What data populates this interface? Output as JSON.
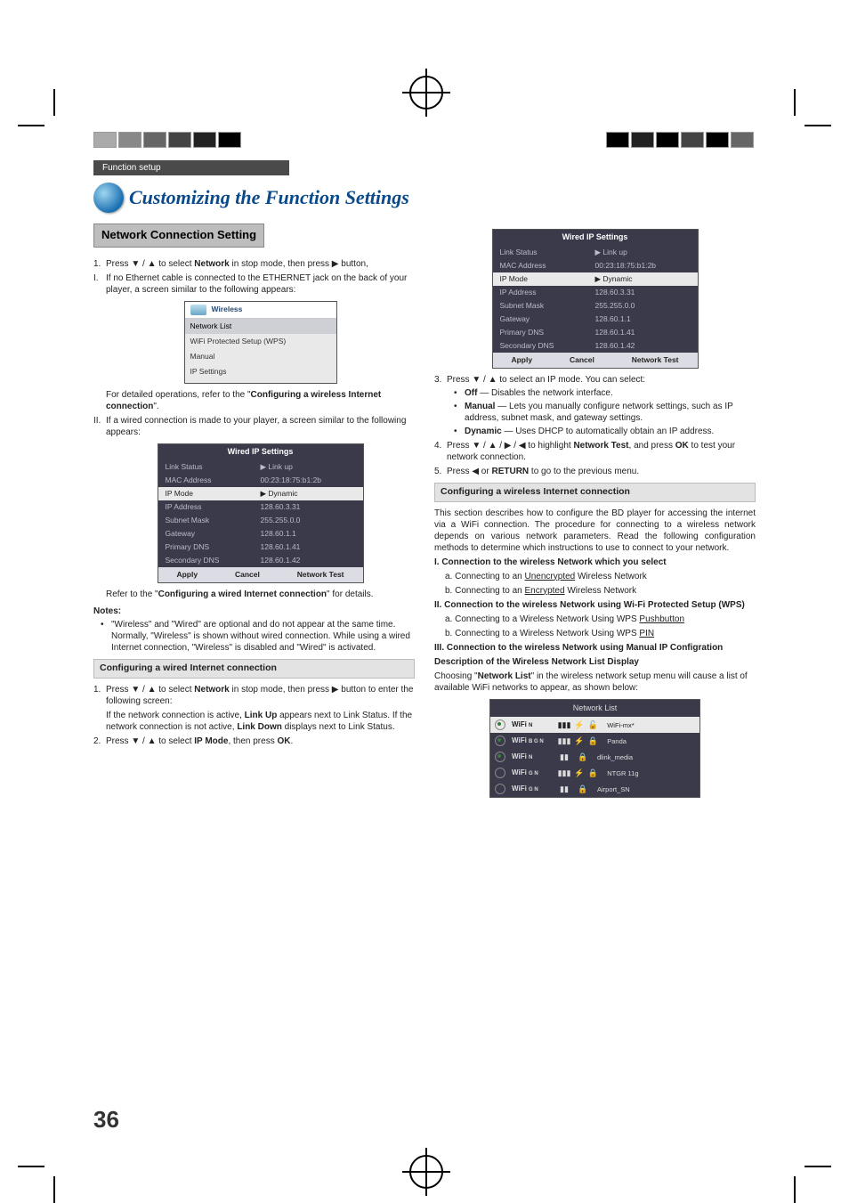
{
  "header": {
    "breadcrumb": "Function setup"
  },
  "title": "Customizing the Function Settings",
  "left": {
    "section_title": "Network Connection Setting",
    "step1_pre": "Press ▼ / ▲ to select ",
    "step1_bold": "Network",
    "step1_post": " in stop mode, then press ▶ button,",
    "sI_label": "I.",
    "sI_text": "If no Ethernet cable is connected to the ETHERNET jack on the back of your player, a screen similar to the following appears:",
    "wireless_box": {
      "title": "Wireless",
      "items": [
        "Network List",
        "WiFi Protected Setup (WPS)",
        "Manual",
        "IP Settings"
      ]
    },
    "sI_ref_pre": "For detailed operations, refer to the \"",
    "sI_ref_bold": "Configuring a wireless Internet connection",
    "sI_ref_post": "\".",
    "sII_label": "II.",
    "sII_text": "If a wired connection is made to your player, a screen similar to the following appears:",
    "wired_table": {
      "title": "Wired IP Settings",
      "rows": [
        {
          "k": "Link Status",
          "v": "▶   Link up"
        },
        {
          "k": "MAC Address",
          "v": "00:23:18:75:b1:2b"
        },
        {
          "k": "IP Mode",
          "v": "▶   Dynamic",
          "sel": true
        },
        {
          "k": "IP Address",
          "v": "128.60.3.31"
        },
        {
          "k": "Subnet Mask",
          "v": "255.255.0.0"
        },
        {
          "k": "Gateway",
          "v": "128.60.1.1"
        },
        {
          "k": "Primary DNS",
          "v": "128.60.1.41"
        },
        {
          "k": "Secondary DNS",
          "v": "128.60.1.42"
        }
      ],
      "buttons": [
        "Apply",
        "Cancel",
        "Network Test"
      ]
    },
    "sII_ref_pre": "Refer to the \"",
    "sII_ref_bold": "Configuring a wired Internet connection",
    "sII_ref_post": "\" for details.",
    "notes_hd": "Notes:",
    "note1": "\"Wireless\" and \"Wired\" are optional and do not appear at the same time. Normally, \"Wireless\" is shown without wired connection. While using a wired Internet connection, \"Wireless\" is disabled and \"Wired\" is activated.",
    "sub_wired": "Configuring a wired Internet connection",
    "w1_pre": "Press ▼ / ▲ to select ",
    "w1_bold": "Network",
    "w1_post": " in stop mode, then press ▶ button to enter the following screen:",
    "w1b_pre": "If the network connection is active, ",
    "w1b_bold": "Link Up",
    "w1b_mid": " appears next to Link Status. If the network connection is not active, ",
    "w1b_bold2": "Link Down",
    "w1b_post": " displays next to Link Status.",
    "w2_pre": "Press ▼ / ▲ to select ",
    "w2_bold": "IP Mode",
    "w2_post": ", then press ",
    "w2_bold2": "OK",
    "w2_post2": "."
  },
  "right": {
    "wired_table": {
      "title": "Wired IP Settings",
      "rows": [
        {
          "k": "Link Status",
          "v": "▶   Link up"
        },
        {
          "k": "MAC Address",
          "v": "00:23:18:75:b1:2b"
        },
        {
          "k": "IP Mode",
          "v": "▶   Dynamic",
          "sel": true
        },
        {
          "k": "IP Address",
          "v": "128.60.3.31"
        },
        {
          "k": "Subnet Mask",
          "v": "255.255.0.0"
        },
        {
          "k": "Gateway",
          "v": "128.60.1.1"
        },
        {
          "k": "Primary DNS",
          "v": "128.60.1.41"
        },
        {
          "k": "Secondary DNS",
          "v": "128.60.1.42"
        }
      ],
      "buttons": [
        "Apply",
        "Cancel",
        "Network Test"
      ]
    },
    "s3_text": "Press ▼ / ▲ to select an IP mode. You can select:",
    "s3_items": [
      {
        "b": "Off",
        "t": " — Disables the network interface."
      },
      {
        "b": "Manual",
        "t": " — Lets you manually configure network settings, such as IP address, subnet mask, and gateway settings."
      },
      {
        "b": "Dynamic",
        "t": " — Uses DHCP to automatically obtain an IP address."
      }
    ],
    "s4_pre": "Press ▼ / ▲ / ▶ / ◀ to highlight ",
    "s4_bold": "Network Test",
    "s4_mid": ", and press ",
    "s4_bold2": "OK",
    "s4_post": " to test your network connection.",
    "s5_pre": "Press ◀ or ",
    "s5_bold": "RETURN",
    "s5_post": " to go to the previous menu.",
    "sub_wireless": "Configuring a wireless Internet connection",
    "wl_intro": "This section describes how to configure the BD player for accessing the internet via a WiFi connection. The procedure for connecting to a wireless network depends on various network parameters. Read the following configuration methods to determine which instructions to use to connect to your network.",
    "wl_I_b": "I.  Connection to the wireless Network which you select",
    "wl_I_a": "a. Connecting to an ",
    "wl_I_au": "Unencrypted",
    "wl_I_ap": " Wireless Network",
    "wl_I_b2": "b. Connecting to an ",
    "wl_I_bu": "Encrypted",
    "wl_I_bp": " Wireless Network",
    "wl_II_b": "II. Connection to the wireless Network using Wi-Fi Protected Setup (WPS)",
    "wl_II_a": "a. Connecting to a Wireless Network Using WPS ",
    "wl_II_au": "Pushbutton",
    "wl_II_b2": "b. Connecting to a Wireless Network Using WPS ",
    "wl_II_bu": "PIN",
    "wl_III_b": "III. Connection to the wireless Network using Manual IP Configration",
    "desc_hd": "Description of the Wireless Network List Display",
    "desc_pre": "Choosing \"",
    "desc_bold": "Network List",
    "desc_post": "\" in the wireless network setup menu will cause a list of available WiFi networks to appear, as shown below:",
    "netlist": {
      "title": "Network List",
      "rows": [
        {
          "on": true,
          "name": "WiFi",
          "badge": "N",
          "sig": "▮▮▮",
          "wps": "⚡",
          "lock": "🔓",
          "ssid": "WiFi-mx*",
          "sel": true
        },
        {
          "on": true,
          "name": "WiFi",
          "badge": "B G N",
          "sig": "▮▮▮",
          "wps": "⚡",
          "lock": "🔒",
          "ssid": "Panda"
        },
        {
          "on": true,
          "name": "WiFi",
          "badge": "N",
          "sig": "▮▮",
          "wps": "",
          "lock": "🔒",
          "ssid": "dlink_media"
        },
        {
          "on": false,
          "name": "WiFi",
          "badge": "G N",
          "sig": "▮▮▮",
          "wps": "⚡",
          "lock": "🔒",
          "ssid": "NTGR 11g"
        },
        {
          "on": false,
          "name": "WiFi",
          "badge": "G N",
          "sig": "▮▮",
          "wps": "",
          "lock": "🔒",
          "ssid": "Airport_SN"
        }
      ]
    }
  },
  "page_number": "36"
}
